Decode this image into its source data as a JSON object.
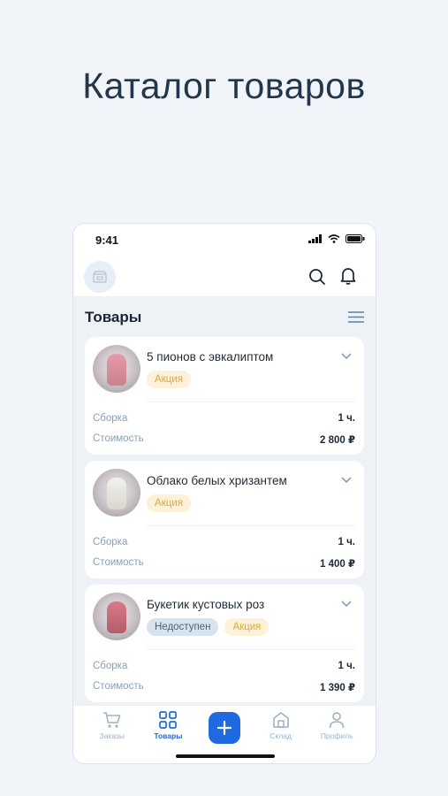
{
  "headline": "Каталог товаров",
  "status": {
    "time": "9:41"
  },
  "section": {
    "title": "Товары"
  },
  "products": [
    {
      "name": "5 пионов с эвкалиптом",
      "tags": [
        "Акция"
      ],
      "rows": [
        {
          "label": "Сборка",
          "value": "1 ч."
        },
        {
          "label": "Стоимость",
          "value": "2 800 ₽"
        }
      ]
    },
    {
      "name": "Облако белых хризантем",
      "tags": [
        "Акция"
      ],
      "rows": [
        {
          "label": "Сборка",
          "value": "1 ч."
        },
        {
          "label": "Стоимость",
          "value": "1 400 ₽"
        }
      ]
    },
    {
      "name": "Букетик кустовых роз",
      "tags": [
        "Недоступен",
        "Акция"
      ],
      "rows": [
        {
          "label": "Сборка",
          "value": "1 ч."
        },
        {
          "label": "Стоимость",
          "value": "1 390 ₽"
        }
      ]
    }
  ],
  "tabbar": {
    "orders": "Заказы",
    "products": "Товары",
    "warehouse": "Склад",
    "profile": "Профиль"
  },
  "colors": {
    "accent": "#1f6ae0",
    "promo_bg": "#fdf1d8",
    "promo_text": "#e1a742",
    "na_bg": "#d7e3ef",
    "na_text": "#4c6178"
  }
}
